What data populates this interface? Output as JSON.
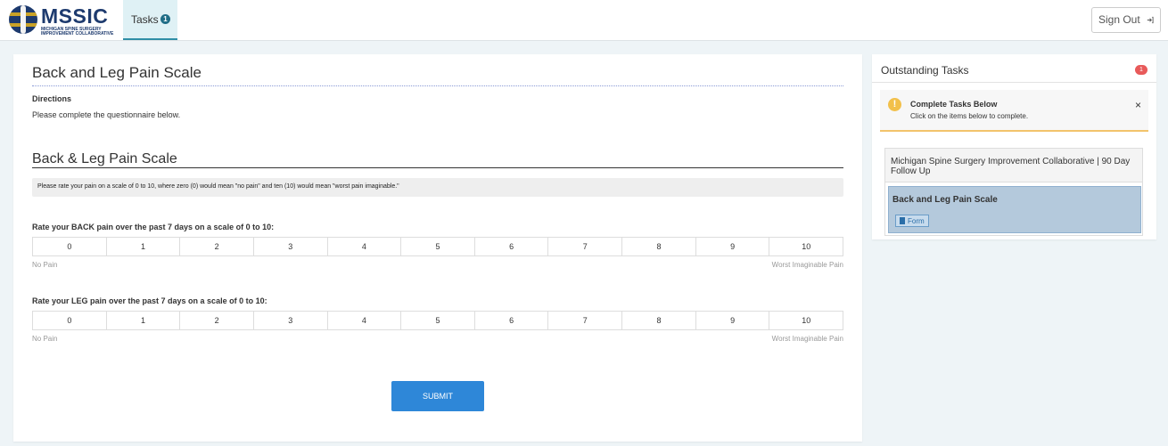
{
  "header": {
    "logo_text": "MSSIC",
    "logo_subtext_1": "MICHIGAN SPINE SURGERY",
    "logo_subtext_2": "IMPROVEMENT COLLABORATIVE",
    "tab_label": "Tasks",
    "tab_badge": "1",
    "signout_label": "Sign Out",
    "signout_icon": "sign-out-icon"
  },
  "form": {
    "title": "Back and Leg Pain Scale",
    "directions_heading": "Directions",
    "directions_text": "Please complete the questionnaire below.",
    "section_title": "Back & Leg Pain Scale",
    "instruction": "Please rate your pain on a scale of 0 to 10, where zero (0) would mean \"no pain\" and ten (10) would mean \"worst pain imaginable.\"",
    "questions": [
      {
        "label": "Rate your BACK pain over the past 7 days on a scale of 0 to 10:",
        "options": [
          "0",
          "1",
          "2",
          "3",
          "4",
          "5",
          "6",
          "7",
          "8",
          "9",
          "10"
        ],
        "low_anchor": "No Pain",
        "high_anchor": "Worst Imaginable Pain"
      },
      {
        "label": "Rate your LEG pain over the past 7 days on a scale of 0 to 10:",
        "options": [
          "0",
          "1",
          "2",
          "3",
          "4",
          "5",
          "6",
          "7",
          "8",
          "9",
          "10"
        ],
        "low_anchor": "No Pain",
        "high_anchor": "Worst Imaginable Pain"
      }
    ],
    "submit_label": "SUBMIT"
  },
  "sidebar": {
    "title": "Outstanding Tasks",
    "badge": "1",
    "alert_title": "Complete Tasks Below",
    "alert_text": "Click on the items below to complete.",
    "alert_icon": "warning-icon",
    "close_symbol": "×",
    "tasks": [
      {
        "label": "Michigan Spine Surgery Improvement Collaborative | 90 Day Follow Up"
      },
      {
        "label": "Back and Leg Pain Scale",
        "link_label": "Form",
        "link_icon": "document-icon"
      }
    ]
  },
  "colors": {
    "brand": "#1d3a6e",
    "accent": "#2f8ea6",
    "submit": "#2e87d8",
    "badge_red": "#e85a5a",
    "warning": "#f2c04a",
    "selected_task": "#b4c9dc"
  }
}
